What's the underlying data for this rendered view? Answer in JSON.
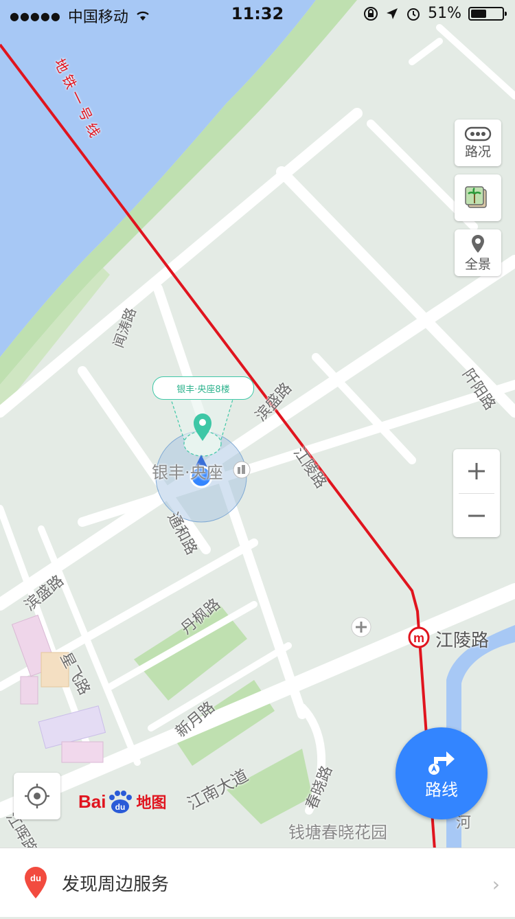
{
  "status_bar": {
    "carrier": "中国移动",
    "time": "11:32",
    "battery": "51%",
    "battery_level": 0.51
  },
  "map": {
    "metro_line_label": "地铁一号线",
    "roads": {
      "binsheng_1": "滨盛路",
      "binsheng_2": "滨盛路",
      "jiangling": "江陵路",
      "tonghe": "通和路",
      "danfeng": "丹枫路",
      "xingfei": "星飞路",
      "xinyue": "新月路",
      "jiangnan": "江南大道",
      "chunxiao": "春晓路",
      "wenchao": "闻涛路",
      "qiyang": "阡阳路",
      "huihui": "江晖路"
    },
    "pois": {
      "building": "银丰·央座",
      "callout": "银丰·央座8楼",
      "metro_station": "江陵路",
      "garden": "钱塘春晓花园",
      "river": "河"
    }
  },
  "controls": {
    "traffic_label": "路况",
    "panorama_label": "全景",
    "zoom_in": "+",
    "zoom_out": "−",
    "route_label": "路线"
  },
  "logo": {
    "bai": "Bai",
    "du": "du",
    "map_text": "地图"
  },
  "bottom_bar": {
    "text": "发现周边服务",
    "chevron": "›"
  },
  "colors": {
    "water": "#a7c8f5",
    "green": "#bfe0b0",
    "metro_line": "#e0141e",
    "accent_blue": "#3385ff",
    "poi_green": "#3ec7a6"
  }
}
